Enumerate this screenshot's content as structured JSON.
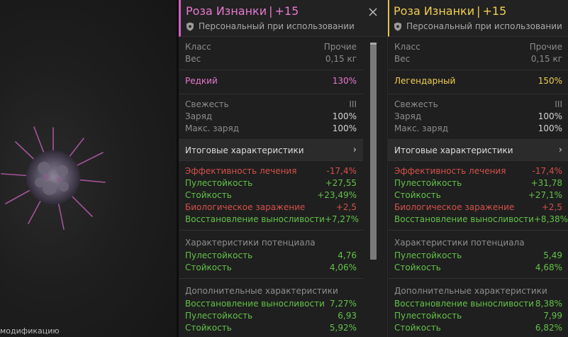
{
  "scene": {
    "caption": "модификацию"
  },
  "panels": [
    {
      "title_name": "Роза Изнанки",
      "title_sep": "|",
      "title_level": "+15",
      "binding": "Персональный при использовании",
      "info": [
        {
          "label": "Класс",
          "value": "Прочие"
        },
        {
          "label": "Вес",
          "value": "0,15 кг"
        }
      ],
      "rarity": {
        "label": "Редкий",
        "value": "130%",
        "color": "#e779cf"
      },
      "status": [
        {
          "label": "Свежесть",
          "value": "III"
        },
        {
          "label": "Заряд",
          "value": "100%"
        },
        {
          "label": "Макс. заряд",
          "value": "100%"
        }
      ],
      "totals_label": "Итоговые характеристики",
      "totals": [
        {
          "label": "Эффективность лечения",
          "value": "-17,4%",
          "tone": "red"
        },
        {
          "label": "Пулестойкость",
          "value": "+27,55",
          "tone": "green"
        },
        {
          "label": "Стойкость",
          "value": "+23,49%",
          "tone": "green"
        },
        {
          "label": "Биологическое заражение",
          "value": "+2,5",
          "tone": "red"
        },
        {
          "label": "Восстановление выносливости",
          "value": "+7,27%",
          "tone": "green"
        }
      ],
      "potential_label": "Характеристики потенциала",
      "potential": [
        {
          "label": "Пулестойкость",
          "value": "4,76"
        },
        {
          "label": "Стойкость",
          "value": "4,06%"
        }
      ],
      "extra_label": "Дополнительные характеристики",
      "extra": [
        {
          "label": "Восстановление выносливости",
          "value": "7,27%"
        },
        {
          "label": "Пулестойкость",
          "value": "6,93"
        },
        {
          "label": "Стойкость",
          "value": "5,92%"
        }
      ]
    },
    {
      "title_name": "Роза Изнанки",
      "title_sep": "|",
      "title_level": "+15",
      "binding": "Персональный при использовании",
      "info": [
        {
          "label": "Класс",
          "value": "Прочие"
        },
        {
          "label": "Вес",
          "value": "0,15 кг"
        }
      ],
      "rarity": {
        "label": "Легендарный",
        "value": "150%",
        "color": "#f0cf52"
      },
      "status": [
        {
          "label": "Свежесть",
          "value": "III"
        },
        {
          "label": "Заряд",
          "value": "100%"
        },
        {
          "label": "Макс. заряд",
          "value": "100%"
        }
      ],
      "totals_label": "Итоговые характеристики",
      "totals": [
        {
          "label": "Эффективность лечения",
          "value": "-17,4%",
          "tone": "red"
        },
        {
          "label": "Пулестойкость",
          "value": "+31,78",
          "tone": "green"
        },
        {
          "label": "Стойкость",
          "value": "+27,1%",
          "tone": "green"
        },
        {
          "label": "Биологическое заражение",
          "value": "+2,5",
          "tone": "red"
        },
        {
          "label": "Восстановление выносливости",
          "value": "+8,38%",
          "tone": "green"
        }
      ],
      "potential_label": "Характеристики потенциала",
      "potential": [
        {
          "label": "Пулестойкость",
          "value": "5,49"
        },
        {
          "label": "Стойкость",
          "value": "4,68%"
        }
      ],
      "extra_label": "Дополнительные характеристики",
      "extra": [
        {
          "label": "Восстановление выносливости",
          "value": "8,38%"
        },
        {
          "label": "Пулестойкость",
          "value": "7,99"
        },
        {
          "label": "Стойкость",
          "value": "6,82%"
        }
      ]
    }
  ],
  "colors": {
    "green": "#62c148",
    "red": "#d4504a",
    "pink": "#e779cf",
    "gold": "#f0cf52"
  },
  "icons": {
    "binding": "shield-icon",
    "close": "close-icon",
    "totals": "chevron-right-icon"
  }
}
